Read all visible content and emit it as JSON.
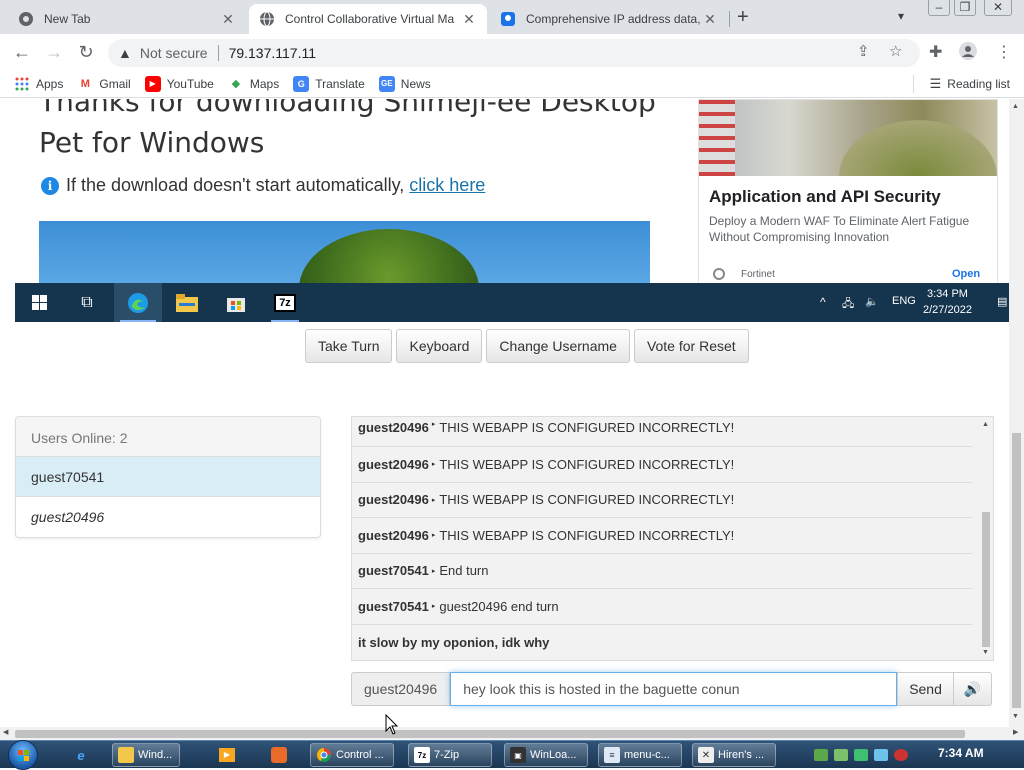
{
  "browser": {
    "tabs": [
      {
        "label": "New Tab",
        "icon": "chrome-icon",
        "active": false
      },
      {
        "label": "Control Collaborative Virtual Ma",
        "icon": "globe-icon",
        "active": true
      },
      {
        "label": "Comprehensive IP address data,",
        "icon": "location-icon",
        "active": false
      }
    ],
    "address": {
      "security": "Not secure",
      "url": "79.137.117.11"
    },
    "bookmarks": [
      {
        "label": "Apps",
        "icon": "apps-grid-icon"
      },
      {
        "label": "Gmail",
        "icon": "gmail-icon"
      },
      {
        "label": "YouTube",
        "icon": "youtube-icon"
      },
      {
        "label": "Maps",
        "icon": "maps-icon"
      },
      {
        "label": "Translate",
        "icon": "translate-icon"
      },
      {
        "label": "News",
        "icon": "news-icon"
      }
    ],
    "reading_list": "Reading list"
  },
  "vm_screen": {
    "page_title_line1": "Thanks for downloading Shimeji-ee Desktop",
    "page_title_line2": "Pet for Windows",
    "download_note": "If the download doesn't start automatically,",
    "download_link": "click here",
    "ad": {
      "title": "Application and API Security",
      "description": "Deploy a Modern WAF To Eliminate Alert Fatigue Without Compromising Innovation",
      "brand": "Fortinet",
      "cta": "Open"
    },
    "taskbar": {
      "language": "ENG",
      "time": "3:34 PM",
      "date": "2/27/2022",
      "app_7zip_label": "7z"
    }
  },
  "controls": {
    "take_turn": "Take Turn",
    "keyboard": "Keyboard",
    "change_username": "Change Username",
    "vote_reset": "Vote for Reset"
  },
  "users": {
    "header": "Users Online: 2",
    "list": [
      "guest70541",
      "guest20496"
    ]
  },
  "chat": {
    "messages": [
      {
        "user": "guest20496",
        "text": "THIS WEBAPP IS CONFIGURED INCORRECTLY!"
      },
      {
        "user": "guest20496",
        "text": "THIS WEBAPP IS CONFIGURED INCORRECTLY!"
      },
      {
        "user": "guest20496",
        "text": "THIS WEBAPP IS CONFIGURED INCORRECTLY!"
      },
      {
        "user": "guest20496",
        "text": "THIS WEBAPP IS CONFIGURED INCORRECTLY!"
      },
      {
        "user": "guest70541",
        "text": "End turn"
      },
      {
        "user": "guest70541",
        "text": "guest20496 end turn"
      }
    ],
    "trailing_text": "it slow by my oponion, idk why",
    "username": "guest20496",
    "input_value": "hey look this is hosted in the baguette conun",
    "send": "Send"
  },
  "host_taskbar": {
    "items": [
      {
        "label": "Wind...",
        "icon": "folder-icon"
      },
      {
        "label": "Control ...",
        "icon": "chrome-icon"
      },
      {
        "label": "7-Zip",
        "icon": "7zip-icon"
      },
      {
        "label": "WinLoa...",
        "icon": "winloader-icon"
      },
      {
        "label": "menu-c...",
        "icon": "notepad-icon"
      },
      {
        "label": "Hiren's ...",
        "icon": "tools-icon"
      }
    ],
    "clock": "7:34 AM"
  },
  "colors": {
    "link": "#1a73a8",
    "selected_user_bg": "#d9edf7",
    "vm_taskbar": "#15344e",
    "input_focus": "#66afe9"
  }
}
